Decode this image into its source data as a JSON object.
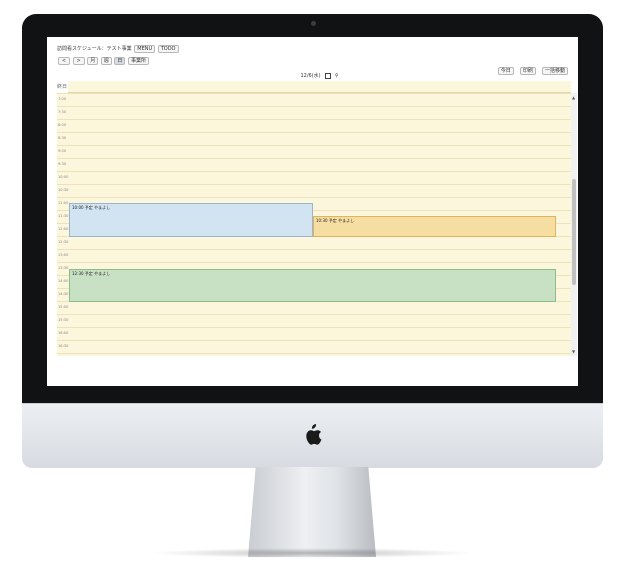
{
  "app": {
    "title": "訪問看スケジュール：テスト事業",
    "menu_button": "MENU",
    "todo_button": "TODO"
  },
  "toolbar": {
    "prev": "<",
    "next": ">",
    "views": [
      "月",
      "週",
      "日",
      "事業所"
    ],
    "active_view": "日",
    "today": "今日",
    "print": "印刷",
    "bulk": "一括移動"
  },
  "date": {
    "label": "12/6(水)"
  },
  "allday": {
    "label": "終日"
  },
  "times": [
    "7:00",
    "7:30",
    "8:00",
    "8:30",
    "9:00",
    "9:30",
    "10:00",
    "10:30",
    "11:00",
    "11:30",
    "12:00",
    "12:30",
    "13:00",
    "13:30",
    "14:00",
    "14:30",
    "15:00",
    "15:30",
    "16:00",
    "16:30",
    "17:00"
  ],
  "events": [
    {
      "label": "10:00 予定 やまよし",
      "color": "blue"
    },
    {
      "label": "10:30 予定 やまよし",
      "color": "orange"
    },
    {
      "label": "12:30 予定 やまよし",
      "color": "green"
    }
  ],
  "colors": {
    "grid_bg": "#fcf6dd",
    "blue": "#d2e3f1",
    "orange": "#f6dea3",
    "green": "#c8e0c3"
  }
}
